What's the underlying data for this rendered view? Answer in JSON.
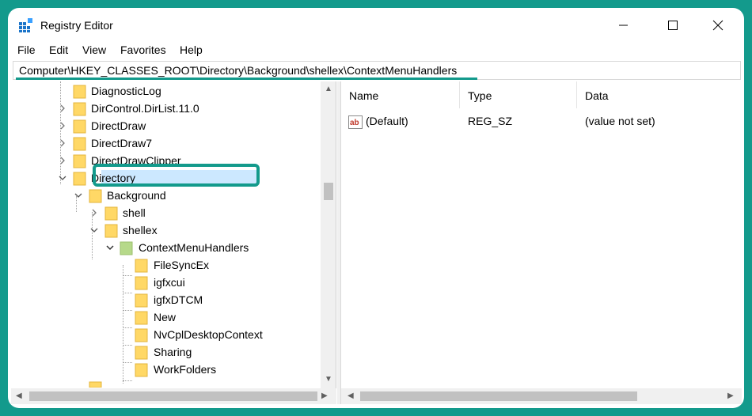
{
  "window": {
    "title": "Registry Editor"
  },
  "menu": [
    "File",
    "Edit",
    "View",
    "Favorites",
    "Help"
  ],
  "address": "Computer\\HKEY_CLASSES_ROOT\\Directory\\Background\\shellex\\ContextMenuHandlers",
  "tree": [
    {
      "label": "DiagnosticLog"
    },
    {
      "label": "DirControl.DirList.11.0"
    },
    {
      "label": "DirectDraw"
    },
    {
      "label": "DirectDraw7"
    },
    {
      "label": "DirectDrawClipper"
    },
    {
      "label": "Directory"
    },
    {
      "label": "Background"
    },
    {
      "label": "shell"
    },
    {
      "label": "shellex"
    },
    {
      "label": "ContextMenuHandlers"
    },
    {
      "label": " FileSyncEx"
    },
    {
      "label": "igfxcui"
    },
    {
      "label": "igfxDTCM"
    },
    {
      "label": "New"
    },
    {
      "label": "NvCplDesktopContext"
    },
    {
      "label": "Sharing"
    },
    {
      "label": "WorkFolders"
    }
  ],
  "columns": {
    "name": "Name",
    "type": "Type",
    "data": "Data"
  },
  "values": [
    {
      "name": "(Default)",
      "type": "REG_SZ",
      "data": "(value not set)",
      "icon": "ab-string-icon"
    }
  ],
  "colors": {
    "accent": "#139a8c",
    "folder": "#ffd866",
    "selection": "#cce8ff"
  }
}
